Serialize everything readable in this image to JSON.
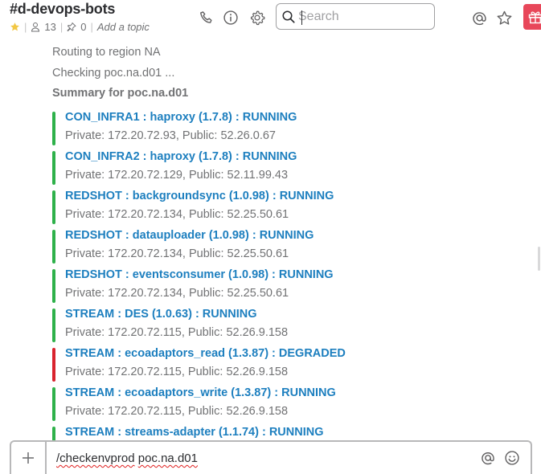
{
  "header": {
    "channel_name": "#d-devops-bots",
    "member_count": "13",
    "pinned_count": "0",
    "topic_placeholder": "Add a topic",
    "search_placeholder": "Search",
    "sep": "|"
  },
  "messages": {
    "line1": "Routing to region NA",
    "line2": "Checking poc.na.d01 ...",
    "summary": "Summary for poc.na.d01",
    "items": [
      {
        "title": "CON_INFRA1  :  haproxy  (1.7.8) : RUNNING",
        "subtitle": "Private: 172.20.72.93, Public: 52.26.0.67",
        "status_color": "#2eb14a"
      },
      {
        "title": "CON_INFRA2  :  haproxy  (1.7.8) : RUNNING",
        "subtitle": "Private: 172.20.72.129, Public: 52.11.99.43",
        "status_color": "#2eb14a"
      },
      {
        "title": "REDSHOT  :  backgroundsync  (1.0.98) : RUNNING",
        "subtitle": "Private: 172.20.72.134, Public: 52.25.50.61",
        "status_color": "#2eb14a"
      },
      {
        "title": "REDSHOT  :  datauploader  (1.0.98) : RUNNING",
        "subtitle": "Private: 172.20.72.134, Public: 52.25.50.61",
        "status_color": "#2eb14a"
      },
      {
        "title": "REDSHOT  :  eventsconsumer  (1.0.98) : RUNNING",
        "subtitle": "Private: 172.20.72.134, Public: 52.25.50.61",
        "status_color": "#2eb14a"
      },
      {
        "title": "STREAM  :  DES  (1.0.63) : RUNNING",
        "subtitle": "Private: 172.20.72.115, Public: 52.26.9.158",
        "status_color": "#2eb14a"
      },
      {
        "title": "STREAM  :  ecoadaptors_read  (1.3.87) : DEGRADED",
        "subtitle": "Private: 172.20.72.115, Public: 52.26.9.158",
        "status_color": "#d9232e"
      },
      {
        "title": "STREAM  :  ecoadaptors_write  (1.3.87) : RUNNING",
        "subtitle": "Private: 172.20.72.115, Public: 52.26.9.158",
        "status_color": "#2eb14a"
      },
      {
        "title": "STREAM  :  streams-adapter  (1.1.74) : RUNNING",
        "subtitle": "",
        "status_color": "#2eb14a"
      }
    ]
  },
  "composer": {
    "cmd": "/checkenvprod",
    "arg": "poc.na.d01"
  },
  "icons": {
    "star": "star-filled-icon",
    "members": "person-icon",
    "pins": "pin-icon",
    "call": "phone-icon",
    "info": "info-icon",
    "settings": "gear-icon",
    "search": "search-icon",
    "mentions": "at-icon",
    "starred": "star-outline-icon",
    "more": "kebab-icon",
    "gift": "gift-icon",
    "plus": "plus-icon",
    "emoji": "smiley-icon"
  },
  "colors": {
    "link": "#1d7fbf",
    "running": "#2eb14a",
    "degraded": "#d9232e",
    "star": "#f2c744",
    "gift": "#e8475a"
  }
}
